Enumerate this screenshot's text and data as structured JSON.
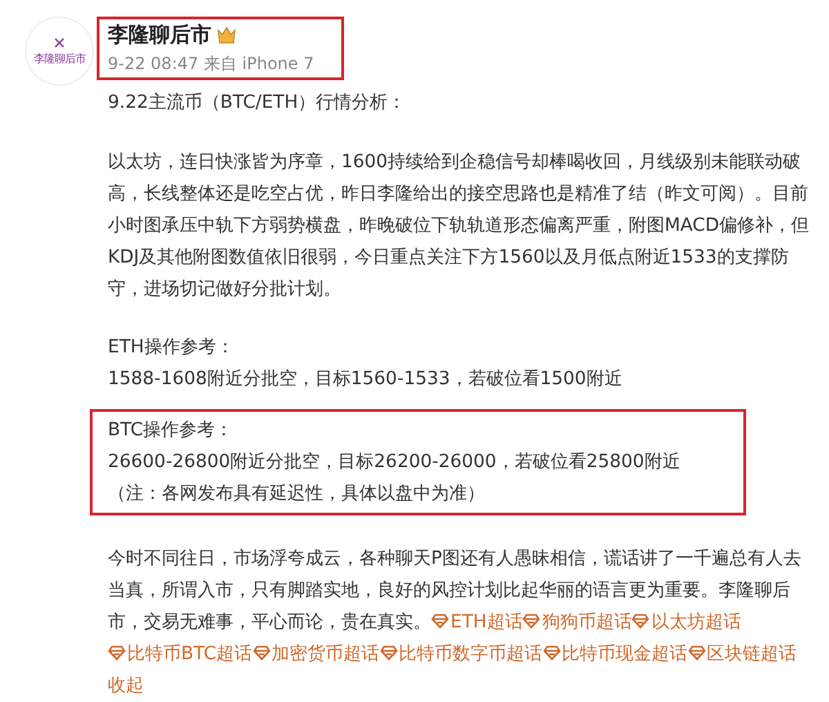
{
  "post": {
    "avatar_text": "李隆聊后市",
    "author": "李隆聊后市",
    "time": "9-22 08:47",
    "source": "来自 iPhone 7",
    "header_highlighted": true,
    "blocks": [
      {
        "highlighted": false,
        "lines": [
          "9.22主流币（BTC/ETH）行情分析："
        ]
      },
      {
        "highlighted": false,
        "lines": [
          "以太坊，连日快涨皆为序章，1600持续给到企稳信号却棒喝收回，月线级别未能联动破高，长线整体还是吃空占优，昨日李隆给出的接空思路也是精准了结（昨文可阅）。目前小时图承压中轨下方弱势横盘，昨晚破位下轨轨道形态偏离严重，附图MACD偏修补，但KDJ及其他附图数值依旧很弱，今日重点关注下方1560以及月低点附近1533的支撑防守，进场切记做好分批计划。"
        ]
      },
      {
        "highlighted": false,
        "lines": [
          "ETH操作参考：",
          "1588-1608附近分批空，目标1560-1533，若破位看1500附近"
        ]
      },
      {
        "highlighted": true,
        "lines": [
          "BTC操作参考：",
          "26600-26800附近分批空，目标26200-26000，若破位看25800附近",
          "（注：各网发布具有延迟性，具体以盘中为准）"
        ]
      }
    ],
    "closing": "今时不同往日，市场浮夸成云，各种聊天P图还有人愚昧相信，谎话讲了一千遍总有人去当真，所谓入市，只有脚踏实地，良好的风控计划比起华丽的语言更为重要。李隆聊后市，交易无难事，平心而论，贵在真实。",
    "tags": [
      "ETH超话",
      "狗狗币超话",
      "以太坊超话",
      "比特币BTC超话",
      "加密货币超话",
      "比特币数字币超话",
      "比特币现金超话",
      "区块链超话"
    ],
    "collapse": "收起"
  }
}
